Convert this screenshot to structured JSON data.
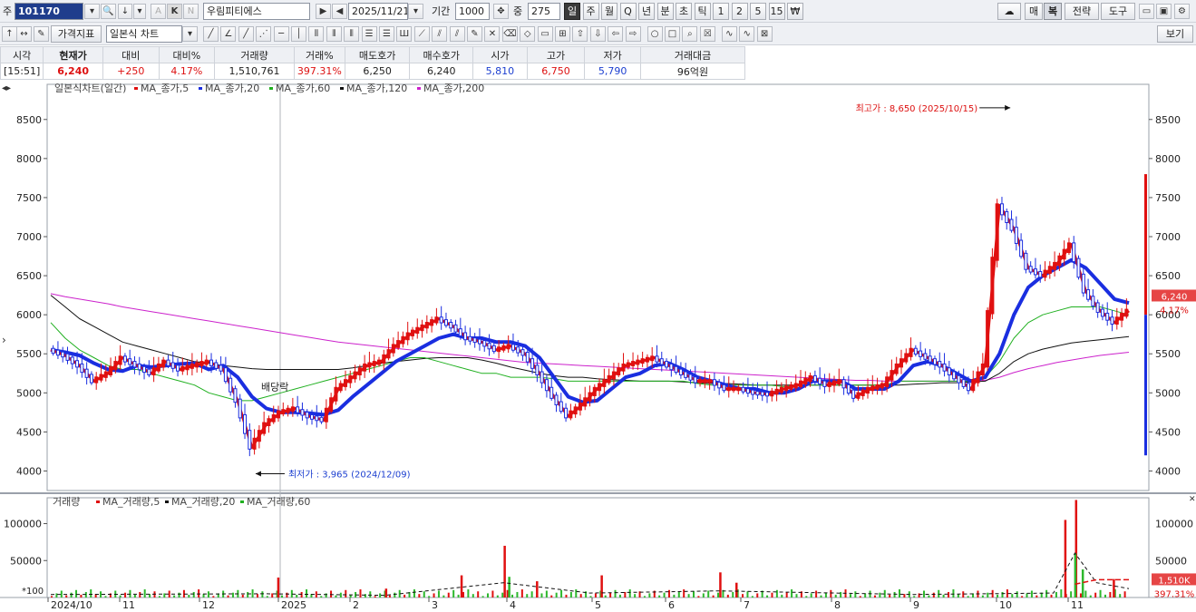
{
  "toolbar": {
    "market_label": "주",
    "code": "101170",
    "stock_name": "우림피티에스",
    "date": "2025/11/21",
    "period_label": "기간",
    "period_value": "1000",
    "count_label": "중",
    "count_value": "275",
    "timeframes": [
      "일",
      "주",
      "월",
      "Q",
      "년",
      "분",
      "초",
      "틱",
      "1",
      "2",
      "5",
      "15",
      "₩"
    ],
    "right_buttons": [
      "매",
      "복",
      "전략",
      "도구"
    ],
    "indicator_btn": "가격지표",
    "chart_type": "일본식 차트",
    "view_btn": "보기"
  },
  "quote": {
    "headers": [
      "시각",
      "현재가",
      "대비",
      "대비%",
      "거래량",
      "거래%",
      "매도호가",
      "매수호가",
      "시가",
      "고가",
      "저가",
      "거래대금"
    ],
    "values": [
      "[15:51]",
      "6,240",
      "+250",
      "4.17%",
      "1,510,761",
      "397.31%",
      "6,250",
      "6,240",
      "5,810",
      "6,750",
      "5,790",
      "96억원"
    ]
  },
  "chart_data": [
    {
      "type": "line",
      "legend_title": "일본식차트(일간)",
      "legend": [
        "MA_종가,5",
        "MA_종가,20",
        "MA_종가,60",
        "MA_종가,120",
        "MA_종가,200"
      ],
      "x_tick_labels": [
        "2024/10",
        "11",
        "12",
        "2025",
        "2",
        "3",
        "4",
        "5",
        "6",
        "7",
        "8",
        "9",
        "10",
        "11"
      ],
      "y_ticks": [
        4000,
        4500,
        5000,
        5500,
        6000,
        6500,
        7000,
        7500,
        8000,
        8500
      ],
      "ylim": [
        3750,
        8950
      ],
      "series": [
        {
          "name": "MA_종가,5",
          "color": "#e01010",
          "values": [
            5550,
            5480,
            5350,
            5150,
            5250,
            5450,
            5350,
            5250,
            5400,
            5300,
            5350,
            5400,
            5300,
            4900,
            4300,
            4600,
            4750,
            4800,
            4700,
            4650,
            5050,
            5200,
            5350,
            5400,
            5600,
            5750,
            5850,
            5950,
            5850,
            5700,
            5650,
            5550,
            5600,
            5500,
            5250,
            4950,
            4700,
            4850,
            5050,
            5200,
            5350,
            5400,
            5450,
            5350,
            5250,
            5150,
            5150,
            5050,
            5050,
            5000,
            4980,
            5050,
            5100,
            5200,
            5100,
            5150,
            4950,
            5050,
            5100,
            5350,
            5550,
            5450,
            5350,
            5200,
            5050,
            5350,
            7400,
            7100,
            6600,
            6500,
            6650,
            6900,
            6300,
            6050,
            5900,
            6050
          ]
        },
        {
          "name": "MA_종가,20",
          "color": "#1a2ee0",
          "values": [
            5550,
            5520,
            5480,
            5380,
            5300,
            5280,
            5350,
            5330,
            5350,
            5370,
            5380,
            5300,
            5350,
            5200,
            4950,
            4800,
            4750,
            4750,
            4740,
            4720,
            4780,
            4950,
            5100,
            5250,
            5400,
            5500,
            5600,
            5700,
            5750,
            5700,
            5700,
            5650,
            5650,
            5600,
            5450,
            5200,
            4950,
            4880,
            4900,
            5050,
            5200,
            5250,
            5350,
            5380,
            5300,
            5200,
            5150,
            5100,
            5050,
            5050,
            5000,
            5000,
            5050,
            5150,
            5150,
            5150,
            5050,
            5050,
            5050,
            5150,
            5350,
            5400,
            5350,
            5250,
            5150,
            5200,
            5500,
            6000,
            6350,
            6500,
            6600,
            6700,
            6600,
            6400,
            6200,
            6150
          ]
        },
        {
          "name": "MA_종가,60",
          "color": "#20b020",
          "values": [
            5900,
            5700,
            5550,
            5450,
            5350,
            5300,
            5300,
            5250,
            5200,
            5150,
            5100,
            5000,
            4950,
            4900,
            4900,
            4950,
            5000,
            5050,
            5100,
            5150,
            5200,
            5250,
            5300,
            5350,
            5400,
            5450,
            5450,
            5400,
            5350,
            5300,
            5250,
            5250,
            5200,
            5200,
            5200,
            5180,
            5150,
            5150,
            5150,
            5150,
            5150,
            5150,
            5150,
            5150,
            5150,
            5120,
            5100,
            5100,
            5100,
            5100,
            5100,
            5080,
            5100,
            5100,
            5100,
            5100,
            5100,
            5100,
            5100,
            5150,
            5150,
            5150,
            5150,
            5150,
            5150,
            5200,
            5400,
            5700,
            5900,
            6000,
            6050,
            6100,
            6100,
            6100,
            6050,
            6000
          ]
        },
        {
          "name": "MA_종가,120",
          "color": "#111111",
          "values": [
            6250,
            6100,
            5950,
            5850,
            5750,
            5650,
            5600,
            5550,
            5500,
            5450,
            5400,
            5380,
            5350,
            5330,
            5310,
            5300,
            5300,
            5300,
            5300,
            5300,
            5300,
            5320,
            5350,
            5380,
            5400,
            5420,
            5440,
            5450,
            5450,
            5450,
            5420,
            5380,
            5330,
            5290,
            5250,
            5220,
            5200,
            5200,
            5180,
            5170,
            5160,
            5150,
            5150,
            5150,
            5140,
            5130,
            5120,
            5120,
            5110,
            5100,
            5100,
            5100,
            5100,
            5100,
            5100,
            5100,
            5100,
            5100,
            5100,
            5100,
            5110,
            5120,
            5130,
            5130,
            5140,
            5150,
            5250,
            5400,
            5500,
            5560,
            5600,
            5640,
            5660,
            5680,
            5700,
            5720
          ]
        },
        {
          "name": "MA_종가,200",
          "color": "#cc22cc",
          "values": [
            6270,
            6230,
            6200,
            6170,
            6140,
            6100,
            6070,
            6040,
            6010,
            5980,
            5950,
            5920,
            5890,
            5860,
            5830,
            5800,
            5770,
            5740,
            5710,
            5680,
            5650,
            5630,
            5610,
            5590,
            5570,
            5550,
            5530,
            5510,
            5490,
            5470,
            5450,
            5430,
            5410,
            5390,
            5380,
            5370,
            5360,
            5350,
            5340,
            5330,
            5320,
            5310,
            5300,
            5290,
            5280,
            5270,
            5260,
            5250,
            5240,
            5230,
            5220,
            5210,
            5200,
            5190,
            5180,
            5170,
            5160,
            5160,
            5150,
            5150,
            5150,
            5150,
            5150,
            5150,
            5150,
            5160,
            5200,
            5260,
            5310,
            5350,
            5390,
            5420,
            5450,
            5480,
            5500,
            5520
          ]
        }
      ],
      "annotations": {
        "high": "최고가 : 8,650 (2025/10/15)",
        "high_value": 8650,
        "low": "최저가 : 3,965 (2024/12/09)",
        "low_value": 3965,
        "event": "배당락",
        "current_price": "6,240",
        "current_pct": "4.17%",
        "current_value": 6240
      }
    },
    {
      "type": "bar",
      "legend_title": "거래량",
      "legend": [
        "MA_거래량,5",
        "MA_거래량,20",
        "MA_거래량,60"
      ],
      "y_ticks": [
        50000,
        100000
      ],
      "ylim": [
        0,
        135000
      ],
      "scale_label": "*100",
      "volume_peaks": [
        {
          "x": 0.21,
          "v": 27000
        },
        {
          "x": 0.31,
          "v": 12000
        },
        {
          "x": 0.38,
          "v": 30000
        },
        {
          "x": 0.42,
          "v": 70000
        },
        {
          "x": 0.45,
          "v": 22000
        },
        {
          "x": 0.51,
          "v": 30000
        },
        {
          "x": 0.62,
          "v": 34000
        },
        {
          "x": 0.635,
          "v": 20000
        },
        {
          "x": 0.94,
          "v": 105000
        },
        {
          "x": 0.95,
          "v": 132000
        },
        {
          "x": 0.985,
          "v": 25000
        }
      ],
      "current_volume": "1,510K",
      "current_pct": "397.31%"
    }
  ],
  "colors": {
    "up": "#e01010",
    "down": "#1a2ee0",
    "accent": "#1f3d8c"
  }
}
